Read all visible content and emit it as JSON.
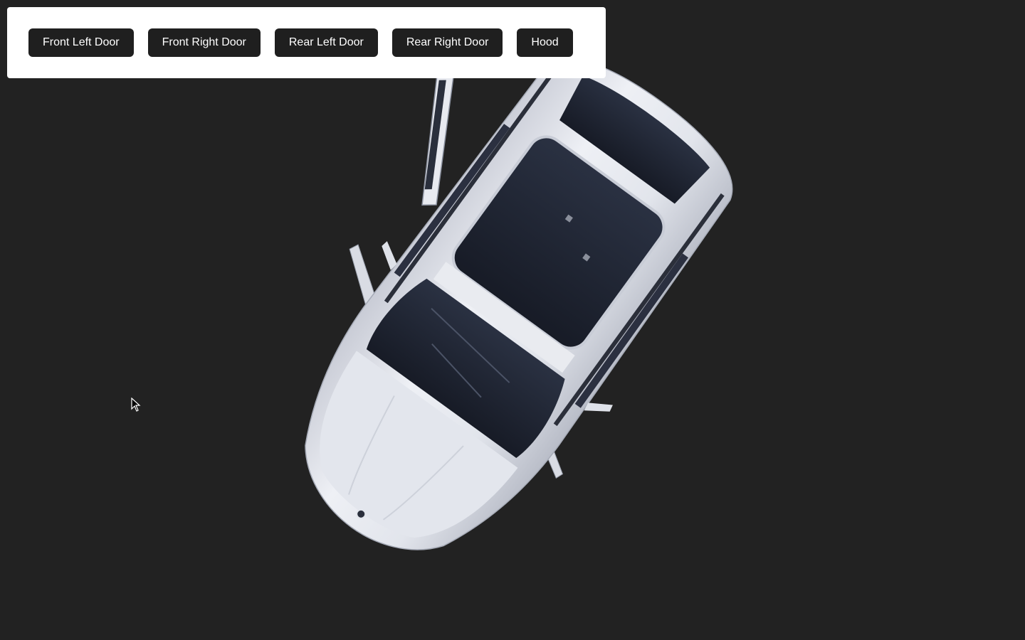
{
  "controls": {
    "buttons": [
      {
        "label": "Front Left Door"
      },
      {
        "label": "Front Right Door"
      },
      {
        "label": "Rear Left Door"
      },
      {
        "label": "Rear Right Door"
      },
      {
        "label": "Hood"
      }
    ]
  },
  "scene": {
    "background_color": "#222222",
    "object": "car-top-view",
    "car_color": "#e4e6ec",
    "glass_color": "#1f2433"
  }
}
